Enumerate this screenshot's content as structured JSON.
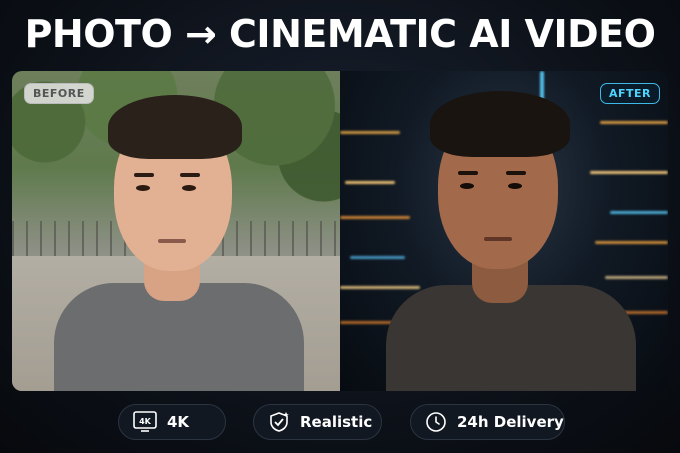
{
  "headline": "PHOTO → CINEMATIC AI VIDEO",
  "labels": {
    "before": "BEFORE",
    "after": "AFTER"
  },
  "badges": [
    {
      "icon": "4k-icon",
      "label": "4K",
      "icon_text": "4K"
    },
    {
      "icon": "shield-check-icon",
      "label": "Realistic"
    },
    {
      "icon": "clock-icon",
      "label": "24h Delivery"
    }
  ],
  "colors": {
    "after_accent": "#4fd3ff",
    "background": "#0b0f16"
  }
}
